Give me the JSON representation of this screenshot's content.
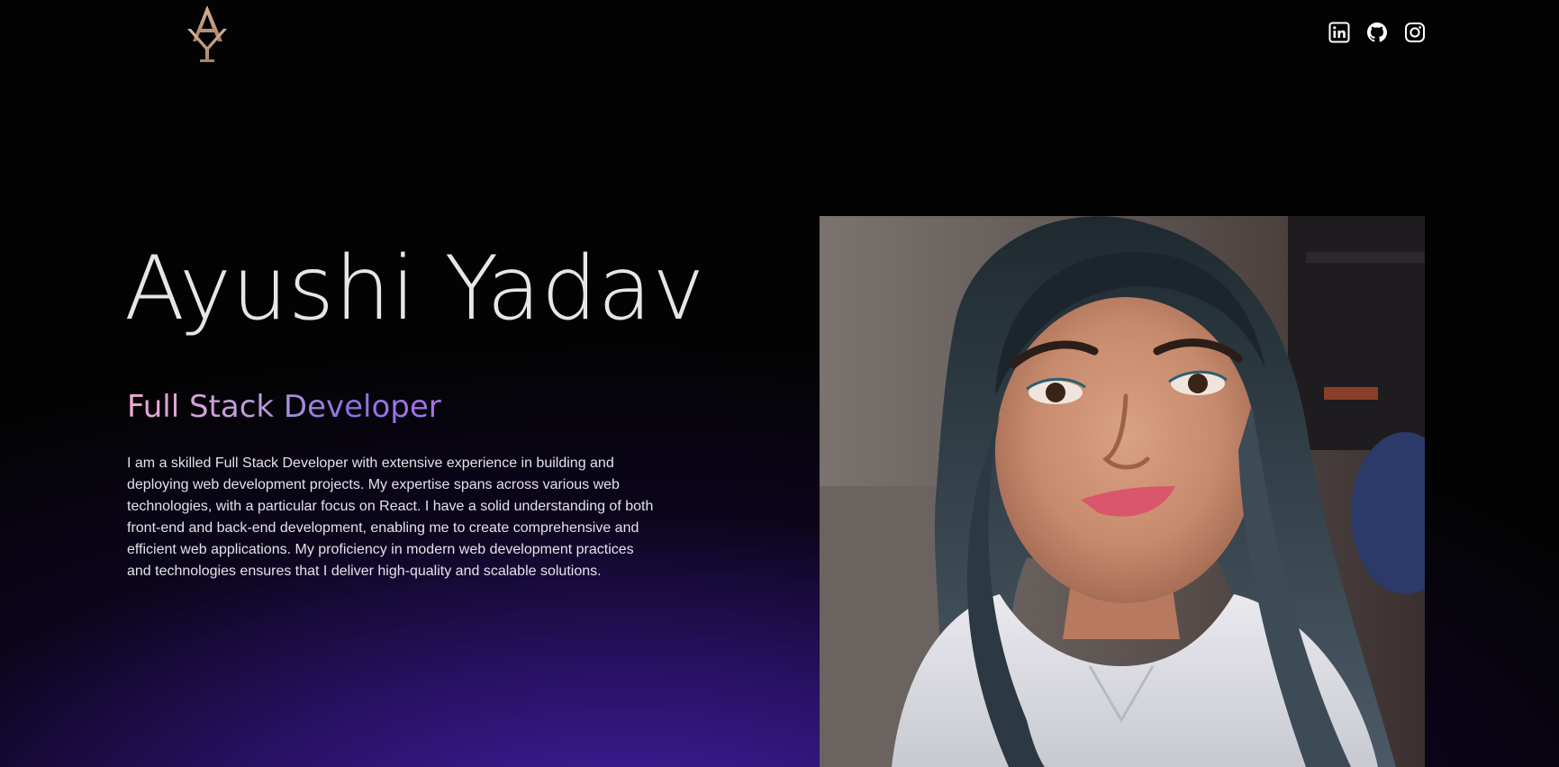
{
  "header": {
    "logo_letters": "AY",
    "logo_color": "#c9a48a",
    "social_links": [
      {
        "icon": "linkedin-icon"
      },
      {
        "icon": "github-icon"
      },
      {
        "icon": "instagram-icon"
      }
    ]
  },
  "hero": {
    "name": "Ayushi Yadav",
    "role": "Full Stack Developer",
    "bio": "I am a skilled Full Stack Developer with extensive experience in building and deploying web development projects. My expertise spans across various web technologies, with a particular focus on React. I have a solid understanding of both front-end and back-end development, enabling me to create comprehensive and efficient web applications. My proficiency in modern web development practices and technologies ensures that I deliver high-quality and scalable solutions."
  },
  "profile_photo": {
    "icon": "profile-photo"
  },
  "colors": {
    "background": "#030303",
    "glow": "#4822b0",
    "name_text": "#e6e6e6",
    "role_gradient_start": "#f3a9d8",
    "role_gradient_end": "#a774ea",
    "bio_text": "#e4e2ea"
  }
}
